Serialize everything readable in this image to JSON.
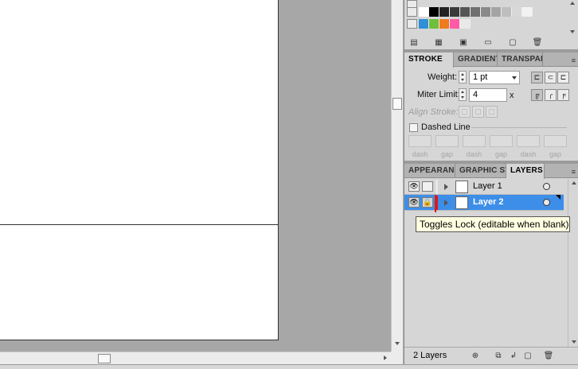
{
  "swatches": {
    "row1": [
      "#ffffff",
      "#000000",
      "#222222",
      "#3a3a3a",
      "#555555",
      "#707070",
      "#8a8a8a",
      "#a4a4a4",
      "#bebebe",
      "#d8d8d8",
      "#f2f2f2"
    ],
    "row2": [
      "#2f8fd8",
      "#6fbf3a",
      "#f07a1e",
      "#ff5aa5",
      "#e9e9e9"
    ],
    "toolbar_icons": [
      "swatch-libraries-icon",
      "show-swatch-kinds-icon",
      "swatch-options-icon",
      "new-color-group-icon",
      "new-swatch-icon",
      "delete-swatch-icon"
    ]
  },
  "stroke_panel": {
    "tabs": [
      "STROKE",
      "GRADIENT",
      "TRANSPARENCY"
    ],
    "weight_label": "Weight:",
    "weight_value": "1 pt",
    "miter_label": "Miter Limit:",
    "miter_value": "4",
    "miter_unit": "x",
    "align_label": "Align Stroke:",
    "dashed_label": "Dashed Line",
    "dash_labels": [
      "dash",
      "gap",
      "dash",
      "gap",
      "dash",
      "gap"
    ]
  },
  "layers_panel": {
    "tabs": [
      "APPEARANCE",
      "GRAPHIC STYLES",
      "LAYERS"
    ],
    "layers": [
      {
        "name": "Layer 1",
        "color": "#e8e8e8",
        "locked": false,
        "selected": false
      },
      {
        "name": "Layer 2",
        "color": "#e01717",
        "locked": true,
        "selected": true
      }
    ],
    "count_text": "2 Layers"
  },
  "tooltip": {
    "text": "Toggles Lock (editable when blank)"
  }
}
